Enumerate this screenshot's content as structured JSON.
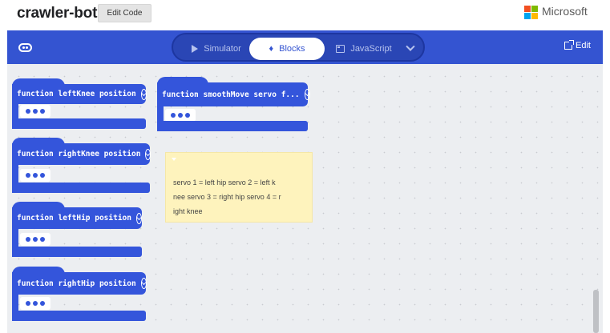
{
  "header": {
    "project_title": "crawler-bot",
    "edit_code_label": "Edit Code",
    "brand_label": "Microsoft",
    "brand_colors": [
      "#f25022",
      "#7fba00",
      "#00a4ef",
      "#ffb900"
    ]
  },
  "toolbar": {
    "tabs": [
      {
        "label": "Simulator",
        "icon": "play-icon",
        "active": false
      },
      {
        "label": "Blocks",
        "icon": "puzzle-icon",
        "active": true
      },
      {
        "label": "JavaScript",
        "icon": "javascript-icon",
        "active": false
      }
    ],
    "more_icon": "chevron-down-icon",
    "edit_label": "Edit",
    "accent": "#3454d1"
  },
  "blocks": [
    {
      "label": "function leftKnee position"
    },
    {
      "label": "function rightKnee position"
    },
    {
      "label": "function leftHip position"
    },
    {
      "label": "function rightHip position"
    },
    {
      "label": "function smoothMove servo f..."
    }
  ],
  "comment": {
    "text": "servo 1 = left hip servo 2 = left k\nnee servo 3 = right hip servo 4 = r\night knee"
  }
}
